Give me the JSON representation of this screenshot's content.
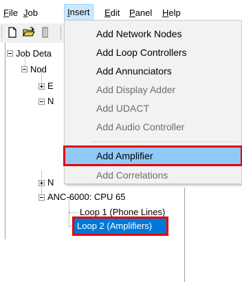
{
  "menubar": {
    "items": [
      {
        "label": "File"
      },
      {
        "label": "Job"
      },
      {
        "label": "Insert"
      },
      {
        "label": "Edit"
      },
      {
        "label": "Panel"
      },
      {
        "label": "Help"
      }
    ]
  },
  "toolbar": {
    "icons": [
      "new-document-icon",
      "open-folder-icon"
    ]
  },
  "tree": {
    "nodes": [
      {
        "label": "Job Deta"
      },
      {
        "label": "Nod"
      },
      {
        "label": "E"
      },
      {
        "label": "N"
      },
      {
        "label": "N"
      },
      {
        "label": "ANC-6000: CPU 65"
      },
      {
        "label": "Loop 1  (Phone Lines)"
      },
      {
        "label": "Loop 2  (Amplifiers)"
      }
    ]
  },
  "insert_menu": {
    "items": [
      {
        "label": "Add Network Nodes",
        "enabled": true
      },
      {
        "label": "Add Loop Controllers",
        "enabled": true
      },
      {
        "label": "Add Annunciators",
        "enabled": true
      },
      {
        "label": "Add Display Adder",
        "enabled": false
      },
      {
        "label": "Add UDACT",
        "enabled": false
      },
      {
        "label": "Add Audio Controller",
        "enabled": false
      },
      {
        "label": "Add Amplifier",
        "enabled": true,
        "highlighted": true
      },
      {
        "label": "Add Correlations",
        "enabled": false
      }
    ]
  },
  "colors": {
    "selection": "#0078d7",
    "annotation_red": "#e60000",
    "menu_hover": "#91c9f7"
  }
}
